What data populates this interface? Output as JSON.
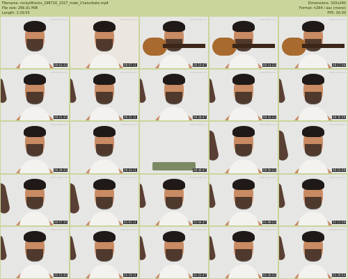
{
  "header": {
    "left_lines": [
      "Filename: rockyt8rocks_298716_2327_male_Chaturbate.mp4",
      "File size: 266.91 MiB",
      "Length: 1:29:55"
    ],
    "right_lines": [
      "Dimensions: 320x240",
      "Format: h264 / aac (mono)",
      "FPS: 30.00"
    ]
  },
  "tiles": [
    {
      "timestamp": "00:03:35",
      "watermark": "Chaturbate.com"
    },
    {
      "timestamp": "00:07:11",
      "watermark": "Chaturbate.com"
    },
    {
      "timestamp": "00:10:47",
      "watermark": "Chaturbate.com"
    },
    {
      "timestamp": "00:14:23",
      "watermark": "Chaturbate.com"
    },
    {
      "timestamp": "00:17:59",
      "watermark": "Chaturbate.com"
    },
    {
      "timestamp": "00:21:35",
      "watermark": "Chaturbate.com"
    },
    {
      "timestamp": "00:25:11",
      "watermark": "Chaturbate.com"
    },
    {
      "timestamp": "00:28:47",
      "watermark": "Chaturbate.com"
    },
    {
      "timestamp": "00:32:23",
      "watermark": "Chaturbate.com"
    },
    {
      "timestamp": "00:35:59",
      "watermark": "Chaturbate.com"
    },
    {
      "timestamp": "00:39:35",
      "watermark": "Chaturbate.com"
    },
    {
      "timestamp": "00:43:11",
      "watermark": "Chaturbate.com"
    },
    {
      "timestamp": "00:46:47",
      "watermark": "Chaturbate.com"
    },
    {
      "timestamp": "00:50:23",
      "watermark": "Chaturbate.com"
    },
    {
      "timestamp": "00:53:59",
      "watermark": "Chaturbate.com"
    },
    {
      "timestamp": "00:57:35",
      "watermark": "Chaturbate.com"
    },
    {
      "timestamp": "01:01:11",
      "watermark": "Chaturbate.com"
    },
    {
      "timestamp": "01:04:47",
      "watermark": "Chaturbate.com"
    },
    {
      "timestamp": "01:08:23",
      "watermark": "Chaturbate.com"
    },
    {
      "timestamp": "01:11:59",
      "watermark": "Chaturbate.com"
    },
    {
      "timestamp": "01:15:35",
      "watermark": "Chaturbate.com"
    },
    {
      "timestamp": "01:19:11",
      "watermark": "Chaturbate.com"
    },
    {
      "timestamp": "01:22:47",
      "watermark": "Chaturbate.com"
    },
    {
      "timestamp": "01:26:23",
      "watermark": "Chaturbate.com"
    },
    {
      "timestamp": "01:29:54",
      "watermark": "Chaturbate.com"
    }
  ]
}
